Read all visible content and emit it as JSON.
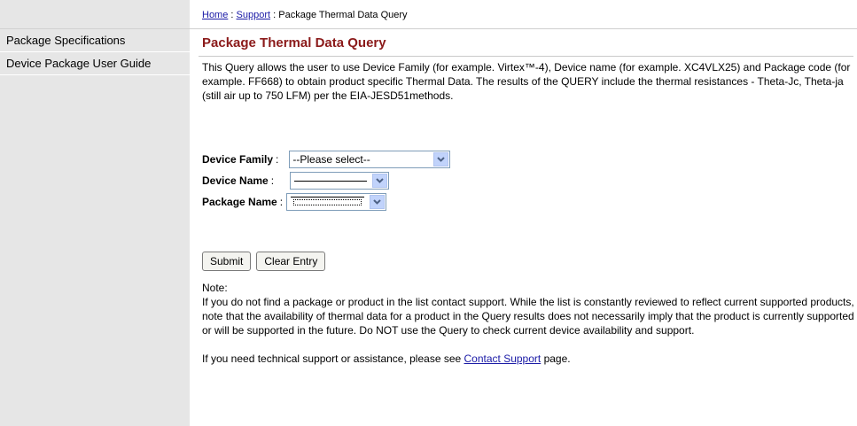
{
  "sidebar": {
    "items": [
      {
        "label": "Package Specifications"
      },
      {
        "label": "Device Package User Guide"
      }
    ]
  },
  "breadcrumb": {
    "home": "Home",
    "sep1": ":",
    "support": "Support",
    "sep2": ":",
    "current": "Package Thermal Data Query"
  },
  "page": {
    "title": "Package Thermal Data Query",
    "intro": "This Query allows the user to use Device Family (for example. Virtex™-4), Device name (for example. XC4VLX25) and Package code (for example. FF668) to obtain product specific Thermal Data. The results of the QUERY include the thermal resistances - Theta-Jc, Theta-ja (still air up to 750 LFM) per the EIA-JESD51methods."
  },
  "form": {
    "family_label": "Device Family",
    "family_value": "--Please select--",
    "device_label": "Device Name",
    "package_label": "Package Name",
    "colon": ":",
    "submit": "Submit",
    "clear": "Clear Entry"
  },
  "note": {
    "heading": "Note:",
    "body": "If you do not find a package or product in the list contact support. While the list is constantly reviewed to reflect current supported products, note that the availability of thermal data for a product in the Query results does not necessarily imply that the product is currently supported or will be supported in the future. Do NOT use the Query to check current device availability and support.",
    "support_prefix": "If you need technical support or assistance, please see ",
    "support_link": "Contact Support",
    "support_suffix": " page."
  },
  "colors": {
    "title": "#8b1a1a",
    "link": "#1a1aa6",
    "sidebar_bg": "#e6e6e6",
    "select_arrow": "#c1d3fb"
  }
}
